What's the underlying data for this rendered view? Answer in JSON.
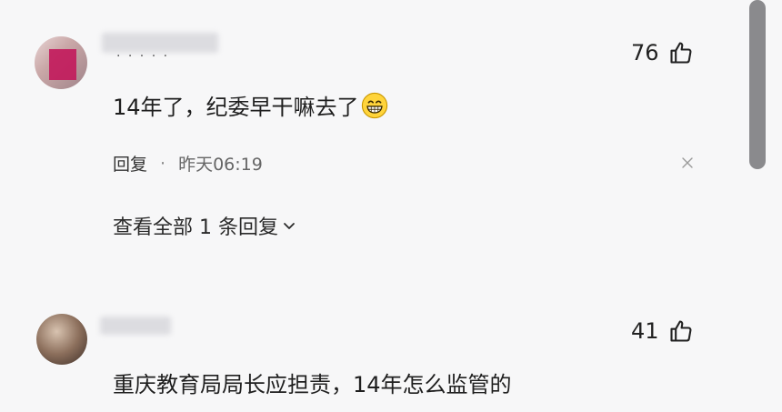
{
  "comments": [
    {
      "likes": "76",
      "text": "14年了，纪委早干嘛去了",
      "emoji": "grinning-emoji",
      "reply_label": "回复",
      "separator": "·",
      "time": "昨天06:19",
      "username_dots": "· · · · ·",
      "view_all_replies": "查看全部 1 条回复"
    },
    {
      "likes": "41",
      "text": "重庆教育局局长应担责，14年怎么监管的"
    }
  ],
  "icons": {
    "like": "thumbs-up-icon",
    "close": "close-icon",
    "expand": "chevron-down-icon"
  }
}
